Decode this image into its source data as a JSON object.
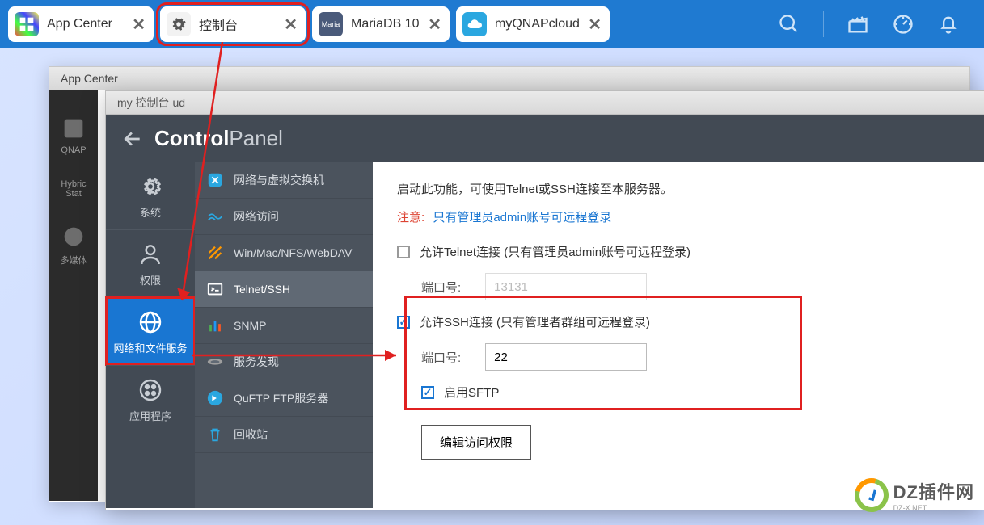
{
  "tabs": [
    {
      "label": "App Center"
    },
    {
      "label": "控制台"
    },
    {
      "label": "MariaDB 10"
    },
    {
      "label": "myQNAPcloud"
    }
  ],
  "app_center": {
    "title": "App Center",
    "side": {
      "qnap": "QNAP",
      "hybrid": "Hybric\nStat",
      "media": "多媒体"
    }
  },
  "control": {
    "win_title": "my 控制台 ud",
    "title_bold": "Control",
    "title_light": "Panel",
    "col1": {
      "system": "系统",
      "priv": "权限",
      "net": "网络和文件服务",
      "app": "应用程序"
    },
    "col2": {
      "net_vswitch": "网络与虚拟交换机",
      "net_access": "网络访问",
      "win_mac": "Win/Mac/NFS/WebDAV",
      "telnet_ssh": "Telnet/SSH",
      "snmp": "SNMP",
      "discovery": "服务发现",
      "quftp": "QuFTP FTP服务器",
      "recycle": "回收站"
    },
    "col3": {
      "intro": "启动此功能，可使用Telnet或SSH连接至本服务器。",
      "note_prefix": "注意:",
      "note_link": "只有管理员admin账号可远程登录",
      "telnet_label": "允许Telnet连接 (只有管理员admin账号可远程登录)",
      "port_label": "端口号:",
      "telnet_port": "13131",
      "ssh_label": "允许SSH连接 (只有管理者群组可远程登录)",
      "ssh_port": "22",
      "sftp_label": "启用SFTP",
      "edit_btn": "编辑访问权限"
    }
  },
  "watermark": {
    "text": "DZ插件网",
    "sub": "DZ-X.NET"
  }
}
